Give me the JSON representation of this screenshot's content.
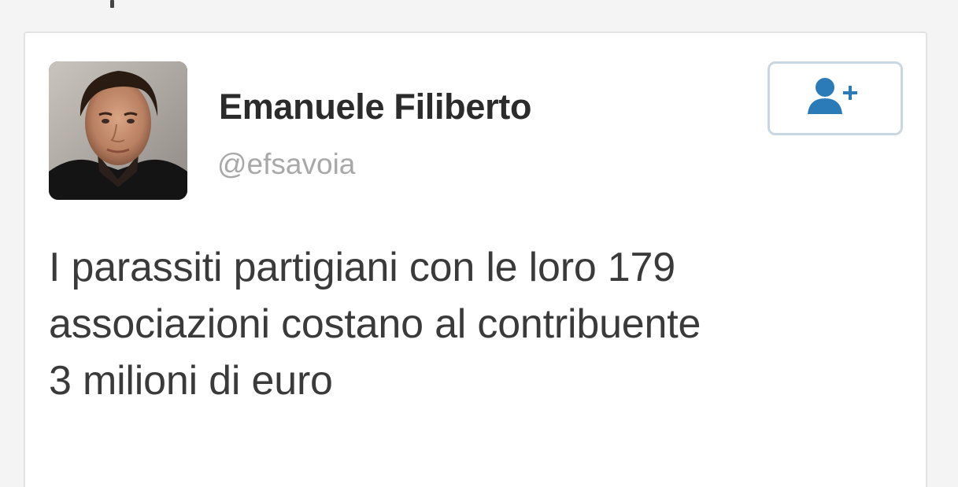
{
  "tweet": {
    "author": {
      "display_name": "Emanuele Filiberto",
      "handle": "@efsavoia",
      "avatar_icon": "profile-photo"
    },
    "follow_button": {
      "icon": "add-user-icon",
      "accent_color": "#2b7bb9",
      "border_color": "#c9d7e2"
    },
    "text_lines": [
      "I parassiti partigiani con le loro 179",
      "associazioni costano al contribuente",
      "3 milioni di euro"
    ]
  }
}
